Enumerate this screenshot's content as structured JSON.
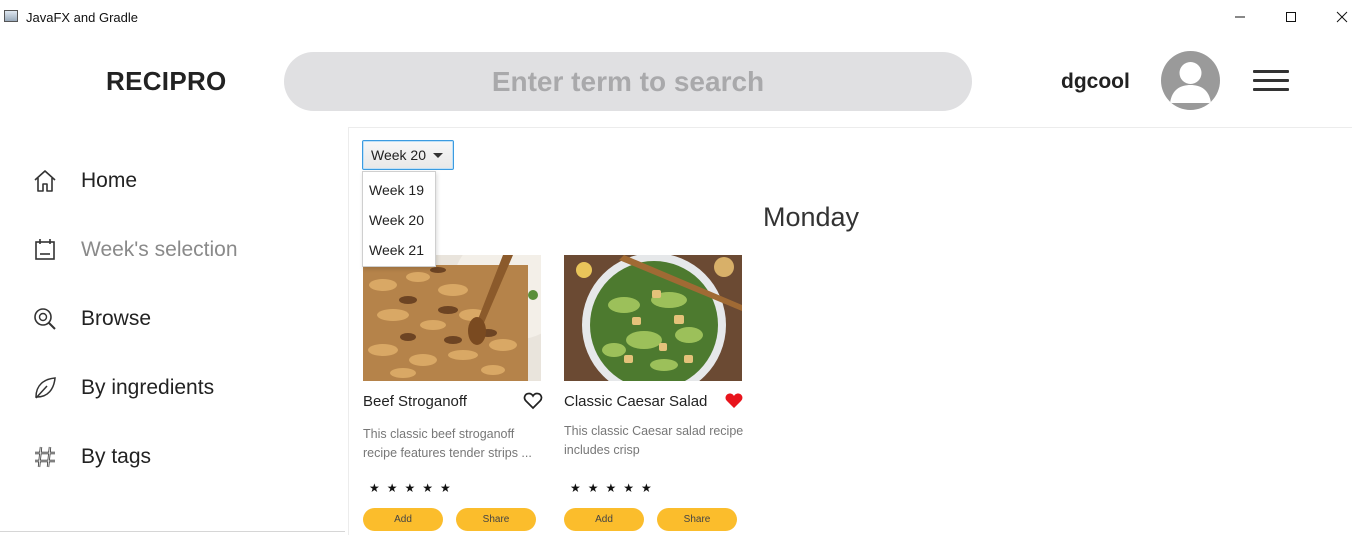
{
  "window": {
    "title": "JavaFX and Gradle",
    "minimize_glyph": "—",
    "maximize_glyph": "☐",
    "close_glyph": "✕"
  },
  "header": {
    "brand": "RECIPRO",
    "search_placeholder": "Enter term to search",
    "username": "dgcool",
    "avatar_icon": "user-avatar-icon",
    "menu_icon": "hamburger-menu-icon"
  },
  "sidebar": {
    "items": [
      {
        "label": "Home",
        "icon": "home-icon",
        "muted": false
      },
      {
        "label": "Week's selection",
        "icon": "calendar-icon",
        "muted": true
      },
      {
        "label": "Browse",
        "icon": "browse-search-icon",
        "muted": false
      },
      {
        "label": "By ingredients",
        "icon": "leaf-icon",
        "muted": false
      },
      {
        "label": "By tags",
        "icon": "hashtag-icon",
        "muted": false
      }
    ]
  },
  "week_selector": {
    "selected": "Week 20",
    "options": [
      "Week 19",
      "Week 20",
      "Week 21"
    ]
  },
  "day": "Monday",
  "recipes": [
    {
      "title": "Beef Stroganoff",
      "description": "This classic beef stroganoff recipe features tender strips ...",
      "favorite": false,
      "rating_stars": "★★★★★",
      "add_label": "Add",
      "share_label": "Share"
    },
    {
      "title": "Classic Caesar Salad",
      "description": "This classic Caesar salad recipe includes crisp",
      "favorite": true,
      "rating_stars": "★★★★★",
      "add_label": "Add",
      "share_label": "Share"
    }
  ],
  "colors": {
    "accent_yellow": "#fbbd2c",
    "favorite_red": "#e8141c",
    "search_bg": "#e0e0e2"
  }
}
